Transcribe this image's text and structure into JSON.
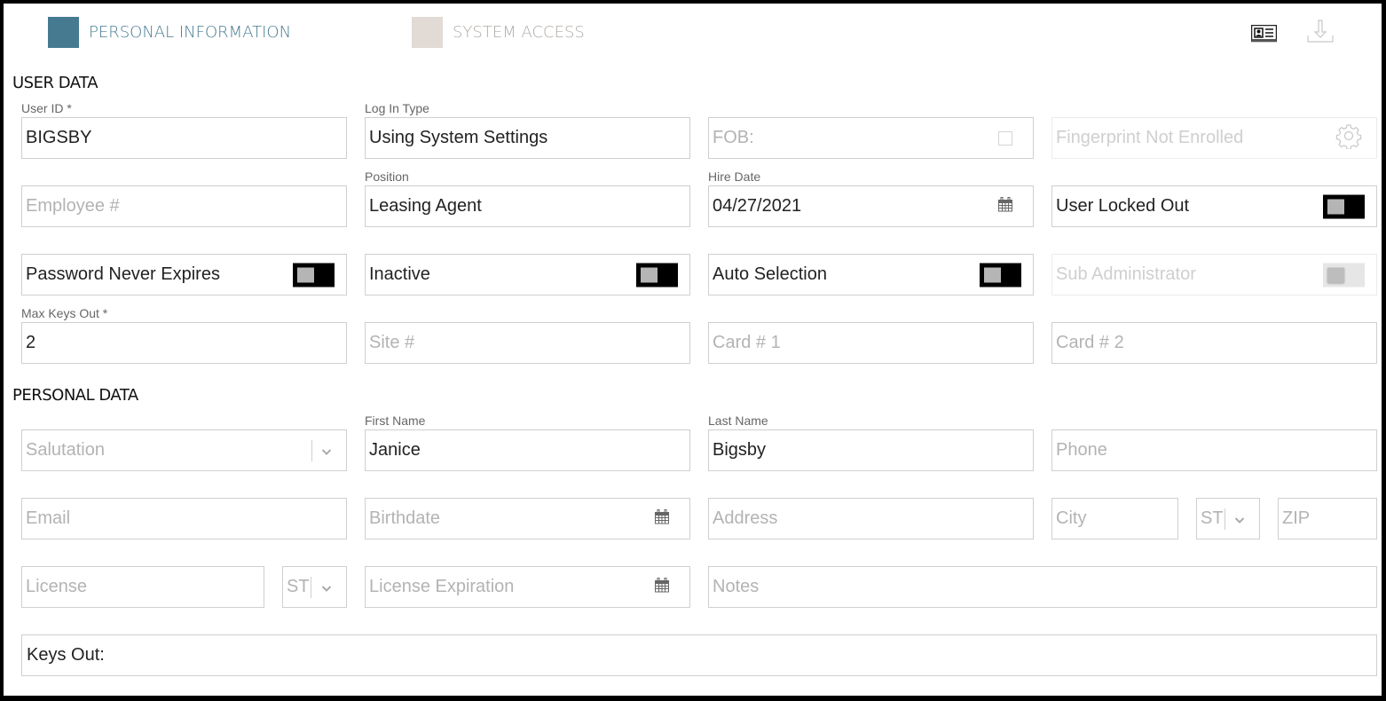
{
  "tabs": [
    {
      "label": "PERSONAL INFORMATION",
      "active": true,
      "color": "#467a91"
    },
    {
      "label": "SYSTEM ACCESS",
      "active": false,
      "color": "#e1dad5"
    }
  ],
  "toolbar": {
    "id_card_icon": "id-card-icon",
    "download_icon": "download-icon"
  },
  "user_data": {
    "title": "USER DATA",
    "user_id": {
      "label": "User ID *",
      "value": "BIGSBY"
    },
    "log_in_type": {
      "label": "Log In Type",
      "value": "Using System Settings"
    },
    "fob": {
      "placeholder": "FOB:",
      "checked": false
    },
    "fingerprint": {
      "text": "Fingerprint Not Enrolled",
      "icon": "gear-icon"
    },
    "employee_no": {
      "placeholder": "Employee #",
      "value": ""
    },
    "position": {
      "label": "Position",
      "value": "Leasing Agent"
    },
    "hire_date": {
      "label": "Hire Date",
      "value": "04/27/2021",
      "icon": "calendar-icon"
    },
    "user_locked_out": {
      "label": "User Locked Out",
      "on": false
    },
    "password_never_expires": {
      "label": "Password Never Expires",
      "on": false
    },
    "inactive": {
      "label": "Inactive",
      "on": false
    },
    "auto_selection": {
      "label": "Auto Selection",
      "on": false
    },
    "sub_administrator": {
      "label": "Sub Administrator",
      "on": false,
      "disabled": true
    },
    "max_keys_out": {
      "label": "Max Keys Out *",
      "value": "2"
    },
    "site_no": {
      "placeholder": "Site #",
      "value": ""
    },
    "card1": {
      "placeholder": "Card # 1",
      "value": ""
    },
    "card2": {
      "placeholder": "Card # 2",
      "value": ""
    }
  },
  "personal_data": {
    "title": "PERSONAL DATA",
    "salutation": {
      "placeholder": "Salutation",
      "value": ""
    },
    "first_name": {
      "label": "First Name",
      "value": "Janice"
    },
    "last_name": {
      "label": "Last Name",
      "value": "Bigsby"
    },
    "phone": {
      "placeholder": "Phone",
      "value": ""
    },
    "email": {
      "placeholder": "Email",
      "value": ""
    },
    "birthdate": {
      "placeholder": "Birthdate",
      "value": ""
    },
    "address": {
      "placeholder": "Address",
      "value": ""
    },
    "city": {
      "placeholder": "City",
      "value": ""
    },
    "state": {
      "placeholder": "ST",
      "value": ""
    },
    "zip": {
      "placeholder": "ZIP",
      "value": ""
    },
    "license": {
      "placeholder": "License",
      "value": ""
    },
    "license_state": {
      "placeholder": "ST",
      "value": ""
    },
    "license_expiration": {
      "placeholder": "License Expiration",
      "value": ""
    },
    "notes": {
      "placeholder": "Notes",
      "value": ""
    },
    "keys_out": {
      "label": "Keys Out:",
      "value": ""
    }
  }
}
